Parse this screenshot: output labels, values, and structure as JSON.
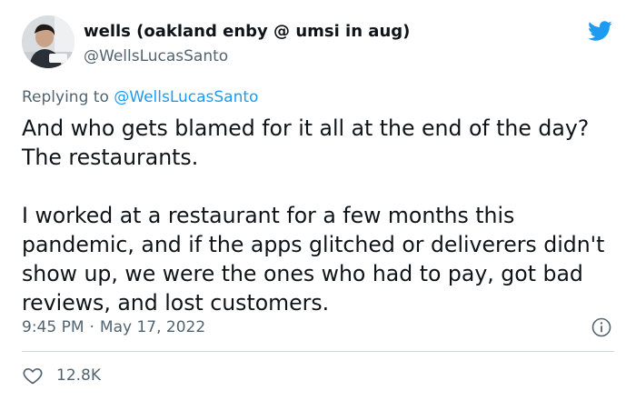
{
  "author": {
    "display_name": "wells (oakland enby @ umsi in aug)",
    "handle": "@WellsLucasSanto",
    "avatar_icon": "avatar-photo"
  },
  "reply": {
    "prefix": "Replying to",
    "to_handle": "@WellsLucasSanto"
  },
  "tweet": {
    "paragraphs": [
      "And who gets blamed for it all at the end of the day? The restaurants.",
      "I worked at a restaurant for a few months this pandemic, and if the apps glitched or deliverers didn't show up, we were the ones who had to pay, got bad reviews, and lost customers."
    ],
    "time": "9:45 PM",
    "separator": "·",
    "date": "May 17, 2022"
  },
  "engagement": {
    "likes": "12.8K"
  },
  "icons": {
    "brand": "twitter-bird-icon",
    "info": "info-icon",
    "like": "heart-icon"
  },
  "colors": {
    "brand_blue": "#1d9bf0",
    "text_primary": "#0f1419",
    "text_secondary": "#536471",
    "divider": "#cfd9de"
  }
}
